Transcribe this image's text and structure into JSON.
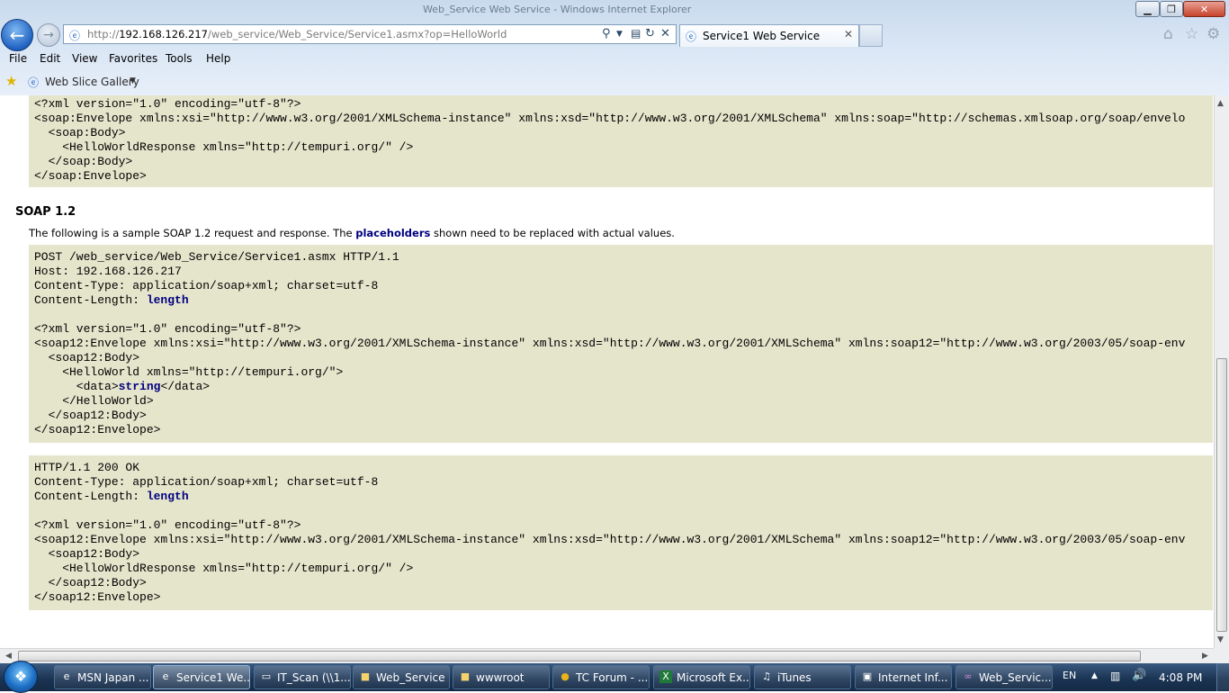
{
  "window": {
    "title": "Web_Service Web Service - Windows Internet Explorer"
  },
  "address_bar": {
    "url_prefix": "http://",
    "url_host": "192.168.126.217",
    "url_path": "/web_service/Web_Service/Service1.asmx?op=HelloWorld"
  },
  "tab": {
    "title": "Service1 Web Service"
  },
  "menu": {
    "items": [
      "File",
      "Edit",
      "View",
      "Favorites",
      "Tools",
      "Help"
    ]
  },
  "favorites_bar": {
    "web_slice_gallery": "Web Slice Gallery"
  },
  "content": {
    "soap11_response_tail": [
      "<?xml version=\"1.0\" encoding=\"utf-8\"?>",
      "<soap:Envelope xmlns:xsi=\"http://www.w3.org/2001/XMLSchema-instance\" xmlns:xsd=\"http://www.w3.org/2001/XMLSchema\" xmlns:soap=\"http://schemas.xmlsoap.org/soap/envelo",
      "  <soap:Body>",
      "    <HelloWorldResponse xmlns=\"http://tempuri.org/\" />",
      "  </soap:Body>",
      "</soap:Envelope>"
    ],
    "soap12": {
      "heading": "SOAP 1.2",
      "intro_before": "The following is a sample SOAP 1.2 request and response. The ",
      "intro_placeholder": "placeholders",
      "intro_after": " shown need to be replaced with actual values.",
      "request": {
        "line1": "POST /web_service/Web_Service/Service1.asmx HTTP/1.1",
        "line2": "Host: 192.168.126.217",
        "line3": "Content-Type: application/soap+xml; charset=utf-8",
        "content_length_label": "Content-Length: ",
        "content_length_placeholder": "length",
        "xml_decl": "<?xml version=\"1.0\" encoding=\"utf-8\"?>",
        "envelope_open": "<soap12:Envelope xmlns:xsi=\"http://www.w3.org/2001/XMLSchema-instance\" xmlns:xsd=\"http://www.w3.org/2001/XMLSchema\" xmlns:soap12=\"http://www.w3.org/2003/05/soap-env",
        "body_open": "  <soap12:Body>",
        "hello_open": "    <HelloWorld xmlns=\"http://tempuri.org/\">",
        "data_open": "      <data>",
        "data_placeholder": "string",
        "data_close": "</data>",
        "hello_close": "    </HelloWorld>",
        "body_close": "  </soap12:Body>",
        "envelope_close": "</soap12:Envelope>"
      },
      "response": {
        "line1": "HTTP/1.1 200 OK",
        "line2": "Content-Type: application/soap+xml; charset=utf-8",
        "content_length_label": "Content-Length: ",
        "content_length_placeholder": "length",
        "xml_decl": "<?xml version=\"1.0\" encoding=\"utf-8\"?>",
        "envelope_open": "<soap12:Envelope xmlns:xsi=\"http://www.w3.org/2001/XMLSchema-instance\" xmlns:xsd=\"http://www.w3.org/2001/XMLSchema\" xmlns:soap12=\"http://www.w3.org/2003/05/soap-env",
        "body_open": "  <soap12:Body>",
        "hello_response": "    <HelloWorldResponse xmlns=\"http://tempuri.org/\" />",
        "body_close": "  </soap12:Body>",
        "envelope_close": "</soap12:Envelope>"
      }
    }
  },
  "taskbar": {
    "items": [
      {
        "label": "MSN Japan ...",
        "icon": "ie-icon"
      },
      {
        "label": "Service1 We...",
        "icon": "ie-icon"
      },
      {
        "label": "IT_Scan (\\\\1...",
        "icon": "network-drive-icon"
      },
      {
        "label": "Web_Service",
        "icon": "folder-icon"
      },
      {
        "label": "wwwroot",
        "icon": "folder-icon"
      },
      {
        "label": "TC Forum - ...",
        "icon": "chrome-icon"
      },
      {
        "label": "Microsoft Ex...",
        "icon": "excel-icon"
      },
      {
        "label": "iTunes",
        "icon": "itunes-icon"
      },
      {
        "label": "Internet Inf...",
        "icon": "iis-icon"
      },
      {
        "label": "Web_Servic...",
        "icon": "visual-studio-icon"
      }
    ],
    "tray": {
      "language": "EN",
      "time": "4:08 PM"
    }
  }
}
